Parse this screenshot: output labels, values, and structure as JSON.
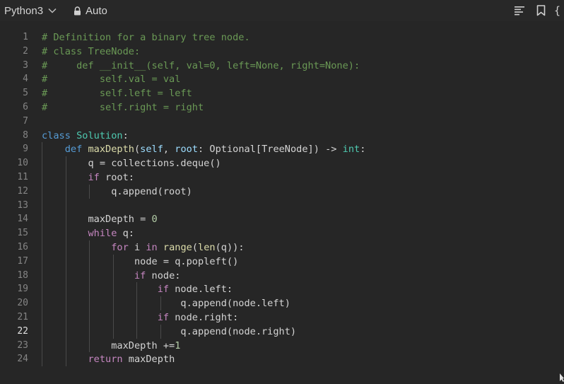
{
  "toolbar": {
    "language": "Python3",
    "mode": "Auto",
    "icons": [
      "align-left-icon",
      "bookmark-icon",
      "braces-icon"
    ],
    "braces_glyph": "{"
  },
  "editor": {
    "active_line": 22,
    "lines": [
      {
        "n": "1",
        "tokens": [
          {
            "t": "# Definition for a binary tree node.",
            "c": "com"
          }
        ]
      },
      {
        "n": "2",
        "tokens": [
          {
            "t": "# class TreeNode:",
            "c": "com"
          }
        ]
      },
      {
        "n": "3",
        "tokens": [
          {
            "t": "#     def __init__(self, val=0, left=None, right=None):",
            "c": "com"
          }
        ]
      },
      {
        "n": "4",
        "tokens": [
          {
            "t": "#         self.val = val",
            "c": "com"
          }
        ]
      },
      {
        "n": "5",
        "tokens": [
          {
            "t": "#         self.left = left",
            "c": "com"
          }
        ]
      },
      {
        "n": "6",
        "tokens": [
          {
            "t": "#         self.right = right",
            "c": "com"
          }
        ]
      },
      {
        "n": "7",
        "tokens": []
      },
      {
        "n": "8",
        "tokens": [
          {
            "t": "class",
            "c": "kw"
          },
          {
            "t": " "
          },
          {
            "t": "Solution",
            "c": "cls"
          },
          {
            "t": ":"
          }
        ]
      },
      {
        "n": "9",
        "tokens": [
          {
            "t": "    "
          },
          {
            "t": "def",
            "c": "kw"
          },
          {
            "t": " "
          },
          {
            "t": "maxDepth",
            "c": "fn"
          },
          {
            "t": "("
          },
          {
            "t": "self",
            "c": "self"
          },
          {
            "t": ", "
          },
          {
            "t": "root",
            "c": "self"
          },
          {
            "t": ": Optional[TreeNode]) -> "
          },
          {
            "t": "int",
            "c": "type"
          },
          {
            "t": ":"
          }
        ]
      },
      {
        "n": "10",
        "tokens": [
          {
            "t": "        q = collections.deque()"
          }
        ]
      },
      {
        "n": "11",
        "tokens": [
          {
            "t": "        "
          },
          {
            "t": "if",
            "c": "ctl"
          },
          {
            "t": " root:"
          }
        ]
      },
      {
        "n": "12",
        "tokens": [
          {
            "t": "            q.append(root)"
          }
        ]
      },
      {
        "n": "13",
        "tokens": []
      },
      {
        "n": "14",
        "tokens": [
          {
            "t": "        maxDepth = "
          },
          {
            "t": "0",
            "c": "num"
          }
        ]
      },
      {
        "n": "15",
        "tokens": [
          {
            "t": "        "
          },
          {
            "t": "while",
            "c": "ctl"
          },
          {
            "t": " q:"
          }
        ]
      },
      {
        "n": "16",
        "tokens": [
          {
            "t": "            "
          },
          {
            "t": "for",
            "c": "ctl"
          },
          {
            "t": " i "
          },
          {
            "t": "in",
            "c": "ctl"
          },
          {
            "t": " "
          },
          {
            "t": "range",
            "c": "fn"
          },
          {
            "t": "("
          },
          {
            "t": "len",
            "c": "fn"
          },
          {
            "t": "(q)):"
          }
        ]
      },
      {
        "n": "17",
        "tokens": [
          {
            "t": "                node = q.popleft()"
          }
        ]
      },
      {
        "n": "18",
        "tokens": [
          {
            "t": "                "
          },
          {
            "t": "if",
            "c": "ctl"
          },
          {
            "t": " node:"
          }
        ]
      },
      {
        "n": "19",
        "tokens": [
          {
            "t": "                    "
          },
          {
            "t": "if",
            "c": "ctl"
          },
          {
            "t": " node.left:"
          }
        ]
      },
      {
        "n": "20",
        "tokens": [
          {
            "t": "                        q.append(node.left)"
          }
        ]
      },
      {
        "n": "21",
        "tokens": [
          {
            "t": "                    "
          },
          {
            "t": "if",
            "c": "ctl"
          },
          {
            "t": " node.right:"
          }
        ]
      },
      {
        "n": "22",
        "tokens": [
          {
            "t": "                        q.append(node.right)"
          }
        ]
      },
      {
        "n": "23",
        "tokens": [
          {
            "t": "            maxDepth +="
          },
          {
            "t": "1",
            "c": "num"
          }
        ]
      },
      {
        "n": "24",
        "tokens": [
          {
            "t": "        "
          },
          {
            "t": "return",
            "c": "ctl"
          },
          {
            "t": " maxDepth"
          }
        ]
      }
    ]
  },
  "colors": {
    "background": "#262626",
    "toolbar": "#282828",
    "comment": "#6a9955",
    "keyword": "#569cd6",
    "control": "#c586c0",
    "class": "#4ec9b0",
    "function": "#dcdcaa",
    "variable": "#9cdcfe",
    "number": "#b5cea8",
    "text": "#d4d4d4"
  }
}
